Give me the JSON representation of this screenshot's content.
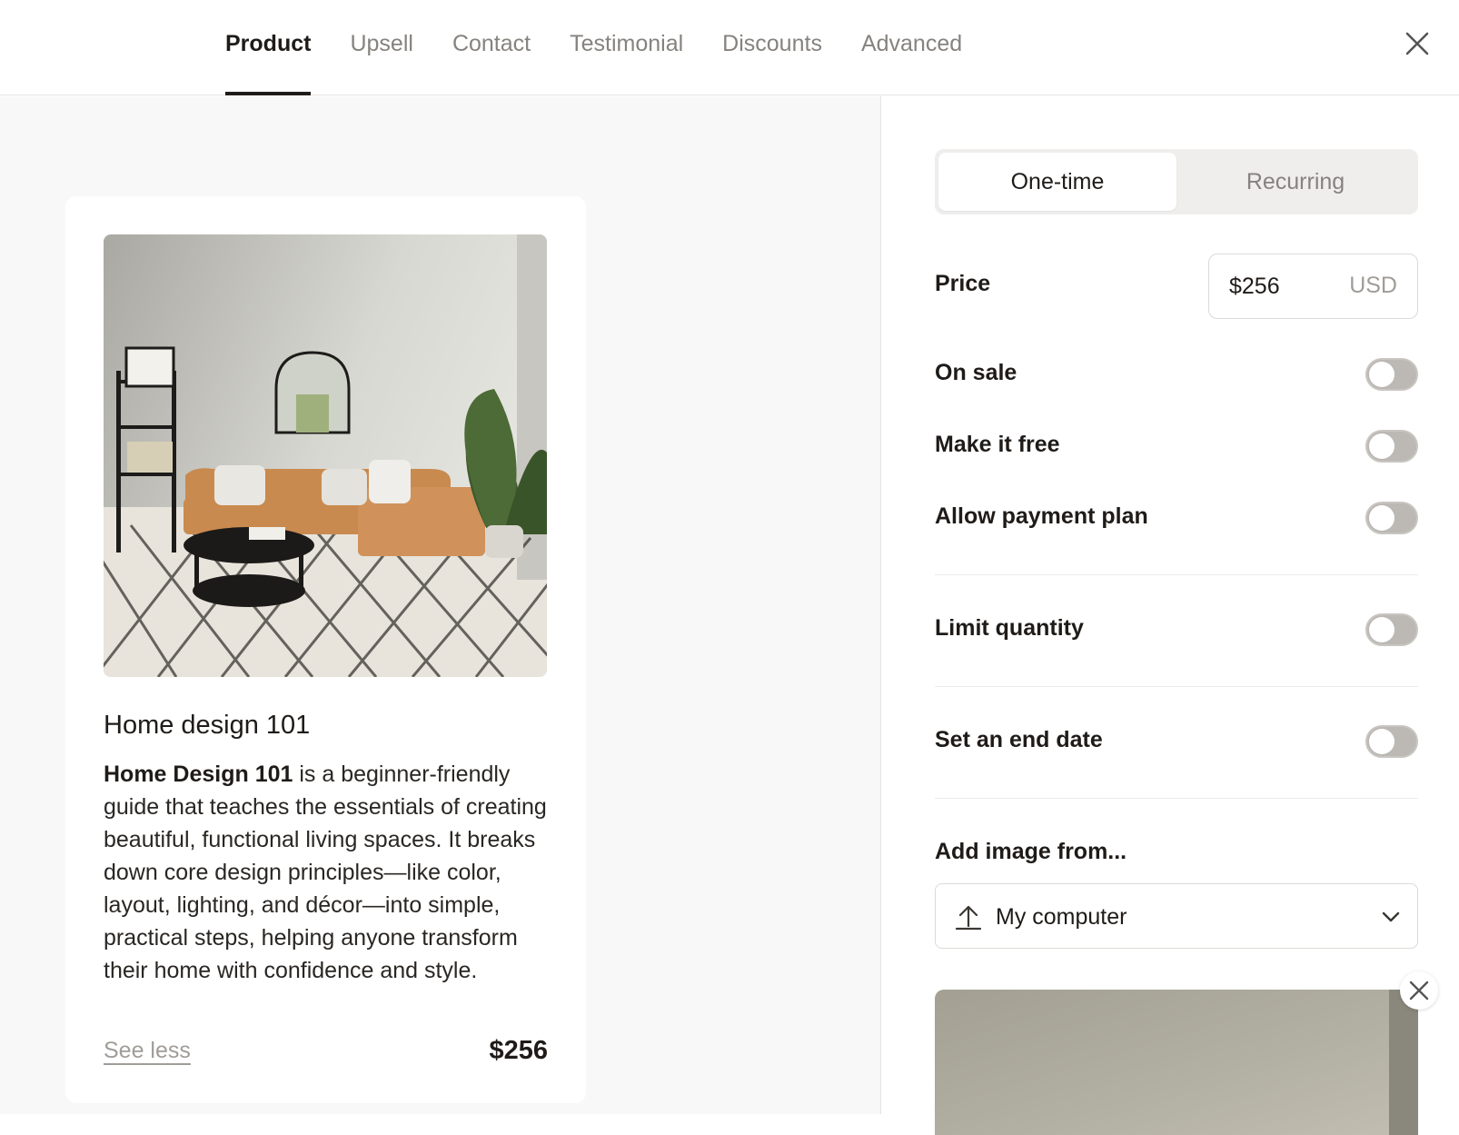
{
  "tabs": [
    {
      "label": "Product"
    },
    {
      "label": "Upsell"
    },
    {
      "label": "Contact"
    },
    {
      "label": "Testimonial"
    },
    {
      "label": "Discounts"
    },
    {
      "label": "Advanced"
    }
  ],
  "card": {
    "title": "Home design 101",
    "desc_bold": "Home Design 101",
    "desc_rest": " is a beginner-friendly guide that teaches the essentials of creating beautiful, functional living spaces. It breaks down core design principles—like color, layout, lighting, and décor—into simple, practical steps, helping anyone transform their home with confidence and style.",
    "see_less": "See less",
    "price": "$256"
  },
  "pricing": {
    "segments": [
      "One-time",
      "Recurring"
    ],
    "price_label": "Price",
    "price_value": "$256",
    "currency": "USD"
  },
  "toggles": {
    "on_sale": "On sale",
    "make_free": "Make it free",
    "payment_plan": "Allow payment plan",
    "limit_quantity": "Limit quantity",
    "end_date": "Set an end date"
  },
  "image": {
    "label": "Add image from...",
    "source": "My computer"
  }
}
